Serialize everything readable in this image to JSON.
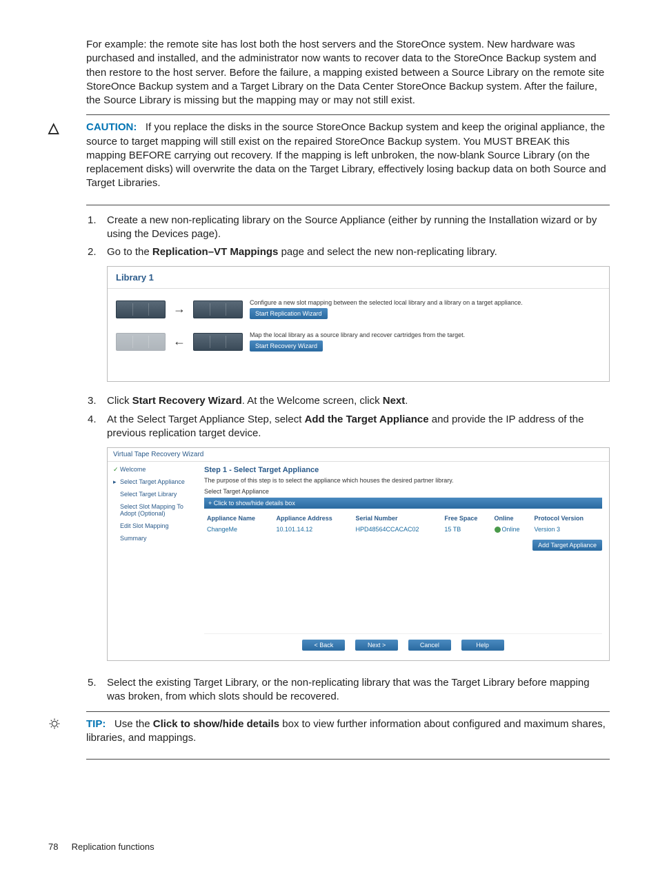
{
  "intro": "For example: the remote site has lost both the host servers and the StoreOnce system. New hardware was purchased and installed, and the administrator now wants to recover data to the StoreOnce Backup system and then restore to the host server. Before the failure, a mapping existed between a Source Library on the remote site StoreOnce Backup system and a Target Library on the Data Center StoreOnce Backup system. After the failure, the Source Library is missing but the mapping may or may not still exist.",
  "caution": {
    "label": "CAUTION:",
    "text": "If you replace the disks in the source StoreOnce Backup system and keep the original appliance, the source to target mapping will still exist on the repaired StoreOnce Backup system. You MUST BREAK this mapping BEFORE carrying out recovery. If the mapping is left unbroken, the now-blank Source Library (on the replacement disks) will overwrite the data on the Target Library, effectively losing backup data on both Source and Target Libraries."
  },
  "steps": {
    "n1": "1.",
    "s1": "Create a new non-replicating library on the Source Appliance (either by running the Installation wizard or by using the Devices page).",
    "n2": "2.",
    "s2a": "Go to the ",
    "s2b": "Replication–VT Mappings",
    "s2c": " page and select the new non-replicating library.",
    "n3": "3.",
    "s3a": "Click ",
    "s3b": "Start Recovery Wizard",
    "s3c": ". At the Welcome screen, click ",
    "s3d": "Next",
    "s3e": ".",
    "n4": "4.",
    "s4a": "At the Select Target Appliance Step, select ",
    "s4b": "Add the Target Appliance",
    "s4c": " and provide the IP address of the previous replication target device.",
    "n5": "5.",
    "s5": "Select the existing Target Library, or the non-replicating library that was the Target Library before mapping was broken, from which slots should be recovered."
  },
  "shot1": {
    "title": "Library 1",
    "row1_text": "Configure a new slot mapping between the selected local library and a library on a target appliance.",
    "row1_btn": "Start Replication Wizard",
    "row2_text": "Map the local library as a source library and recover cartridges from the target.",
    "row2_btn": "Start Recovery Wizard"
  },
  "shot2": {
    "title": "Virtual Tape Recovery Wizard",
    "side": {
      "welcome": "Welcome",
      "sta": "Select Target Appliance",
      "stl": "Select Target Library",
      "ssm": "Select Slot Mapping To Adopt (Optional)",
      "esm": "Edit Slot Mapping",
      "sum": "Summary"
    },
    "step": "Step 1 - Select Target Appliance",
    "desc": "The purpose of this step is to select the appliance which houses the desired partner library.",
    "sub": "Select Target Appliance",
    "detail": "+ Click to show/hide details box",
    "th": {
      "name": "Appliance Name",
      "addr": "Appliance Address",
      "serial": "Serial Number",
      "free": "Free Space",
      "online": "Online",
      "proto": "Protocol Version"
    },
    "td": {
      "name": "ChangeMe",
      "addr": "10.101.14.12",
      "serial": "HPD48564CCACAC02",
      "free": "15 TB",
      "online": "Online",
      "proto": "Version 3"
    },
    "add": "Add Target Appliance",
    "btns": {
      "back": "< Back",
      "next": "Next >",
      "cancel": "Cancel",
      "help": "Help"
    }
  },
  "tip": {
    "label": "TIP:",
    "a": "Use the ",
    "b": "Click to show/hide details",
    "c": " box to view further information about configured and maximum shares, libraries, and mappings."
  },
  "footer": {
    "page": "78",
    "section": "Replication functions"
  }
}
